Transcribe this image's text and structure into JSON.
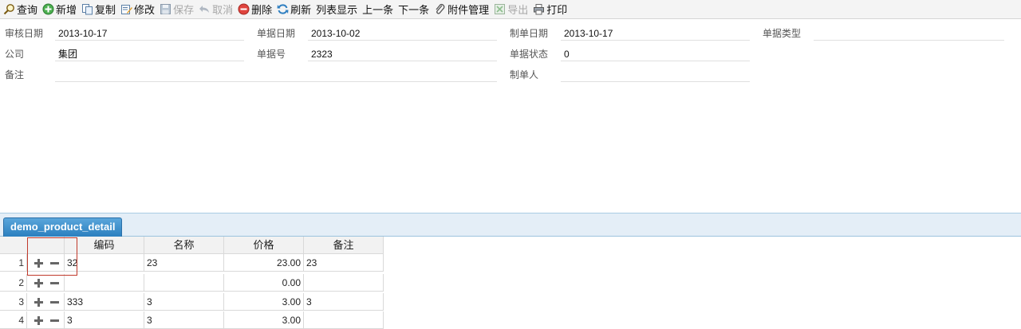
{
  "toolbar": {
    "buttons": [
      {
        "label": "查询",
        "icon": "magnifier-icon",
        "enabled": true
      },
      {
        "label": "新增",
        "icon": "add-circle-icon",
        "enabled": true
      },
      {
        "label": "复制",
        "icon": "copy-icon",
        "enabled": true
      },
      {
        "label": "修改",
        "icon": "edit-icon",
        "enabled": true
      },
      {
        "label": "保存",
        "icon": "save-icon",
        "enabled": false
      },
      {
        "label": "取消",
        "icon": "undo-icon",
        "enabled": false
      },
      {
        "label": "删除",
        "icon": "delete-circle-icon",
        "enabled": true
      },
      {
        "label": "刷新",
        "icon": "refresh-icon",
        "enabled": true
      },
      {
        "label": "列表显示",
        "icon": "",
        "enabled": true
      },
      {
        "label": "上一条",
        "icon": "",
        "enabled": true
      },
      {
        "label": "下一条",
        "icon": "",
        "enabled": true
      },
      {
        "label": "附件管理",
        "icon": "paperclip-icon",
        "enabled": true
      },
      {
        "label": "导出",
        "icon": "excel-export-icon",
        "enabled": false
      },
      {
        "label": "打印",
        "icon": "printer-icon",
        "enabled": true
      }
    ]
  },
  "form": {
    "audit_date": {
      "label": "审核日期",
      "value": "2013-10-17"
    },
    "doc_date": {
      "label": "单据日期",
      "value": "2013-10-02"
    },
    "created_date": {
      "label": "制单日期",
      "value": "2013-10-17"
    },
    "doc_type": {
      "label": "单据类型",
      "value": ""
    },
    "company": {
      "label": "公司",
      "value": "集团"
    },
    "doc_no": {
      "label": "单据号",
      "value": "2323"
    },
    "doc_status": {
      "label": "单据状态",
      "value": "0"
    },
    "remark": {
      "label": "备注",
      "value": ""
    },
    "creator": {
      "label": "制单人",
      "value": ""
    }
  },
  "detail": {
    "tab_label": "demo_product_detail",
    "columns": [
      "编码",
      "名称",
      "价格",
      "备注"
    ],
    "rows": [
      {
        "index": "1",
        "code": "32",
        "name": "23",
        "price": "23.00",
        "note": "23"
      },
      {
        "index": "2",
        "code": "",
        "name": "",
        "price": "0.00",
        "note": ""
      },
      {
        "index": "3",
        "code": "333",
        "name": "3",
        "price": "3.00",
        "note": "3"
      },
      {
        "index": "4",
        "code": "3",
        "name": "3",
        "price": "3.00",
        "note": ""
      }
    ]
  },
  "colors": {
    "tab_active": "#2b7fbf",
    "highlight_box": "#c0392b",
    "disabled_text": "#a8a8a8"
  }
}
